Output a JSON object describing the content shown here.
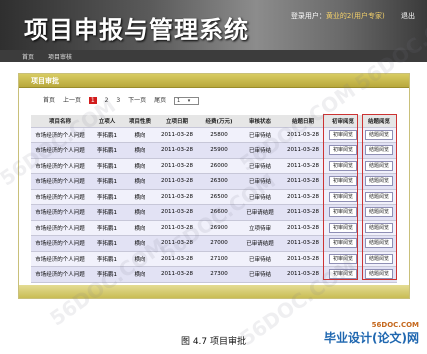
{
  "header": {
    "app_title": "项目申报与管理系统",
    "user_label": "登录用户：",
    "user_name": "黄业的2(用户专家)",
    "logout": "退出"
  },
  "nav": {
    "items": [
      "首页",
      "项目审核"
    ]
  },
  "panel": {
    "title": "项目审批"
  },
  "pager": {
    "first": "首页",
    "prev": "上一页",
    "pages": [
      "1",
      "2",
      "3"
    ],
    "current_page": "1",
    "next": "下一页",
    "last": "尾页",
    "page_select": "1"
  },
  "table": {
    "columns": [
      "项目名称",
      "立项人",
      "项目性质",
      "立项日期",
      "经费(万元)",
      "审核状态",
      "结题日期",
      "初审阅览",
      "结题阅览"
    ],
    "rows": [
      [
        "市场经济的个人问题",
        "李拓鹏1",
        "横向",
        "2011-03-28",
        "25800",
        "已审待结",
        "2011-03-28",
        "初审阅览",
        "结题阅览"
      ],
      [
        "市场经济的个人问题",
        "李拓鹏1",
        "横向",
        "2011-03-28",
        "25900",
        "已审待结",
        "2011-03-28",
        "初审阅览",
        "结题阅览"
      ],
      [
        "市场经济的个人问题",
        "李拓鹏1",
        "横向",
        "2011-03-28",
        "26000",
        "已审待结",
        "2011-03-28",
        "初审阅览",
        "结题阅览"
      ],
      [
        "市场经济的个人问题",
        "李拓鹏1",
        "横向",
        "2011-03-28",
        "26300",
        "已审待结",
        "2011-03-28",
        "初审阅览",
        "结题阅览"
      ],
      [
        "市场经济的个人问题",
        "李拓鹏1",
        "横向",
        "2011-03-28",
        "26500",
        "已审待结",
        "2011-03-28",
        "初审阅览",
        "结题阅览"
      ],
      [
        "市场经济的个人问题",
        "李拓鹏1",
        "横向",
        "2011-03-28",
        "26600",
        "已审请结题",
        "2011-03-28",
        "初审阅览",
        "结题阅览"
      ],
      [
        "市场经济的个人问题",
        "李拓鹏1",
        "横向",
        "2011-03-28",
        "26900",
        "立项待审",
        "2011-03-28",
        "初审阅览",
        "结题阅览"
      ],
      [
        "市场经济的个人问题",
        "李拓鹏1",
        "横向",
        "2011-03-28",
        "27000",
        "已审请结题",
        "2011-03-28",
        "初审阅览",
        "结题阅览"
      ],
      [
        "市场经济的个人问题",
        "李拓鹏1",
        "横向",
        "2011-03-28",
        "27100",
        "已审待结",
        "2011-03-28",
        "初审阅览",
        "结题阅览"
      ],
      [
        "市场经济的个人问题",
        "李拓鹏1",
        "横向",
        "2011-03-28",
        "27300",
        "已审待结",
        "2011-03-28",
        "初审阅览",
        "结题阅览"
      ]
    ]
  },
  "caption": "图 4.7 项目审批",
  "brand": {
    "site": "56DOC.COM",
    "title": "毕业设计(论文)网"
  },
  "watermarks": [
    "56DOC.COM",
    "56DOC.COM",
    "56DOC.COM",
    "56DOC.COM",
    "56DOC.COM",
    "56DOC.COM"
  ],
  "colors": {
    "accent": "#c9bd55",
    "current_page": "#d21c1c",
    "highlight_box": "#cc3333"
  }
}
